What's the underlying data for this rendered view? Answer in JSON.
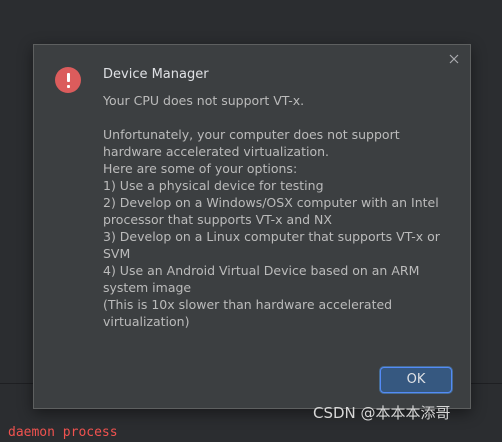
{
  "background": {
    "console_text": "daemon process"
  },
  "dialog": {
    "title": "Device Manager",
    "icon": "error-icon",
    "close_icon": "close-icon",
    "message_lines": [
      "Your CPU does not support VT-x.",
      "",
      "Unfortunately, your computer does not support",
      "hardware accelerated virtualization.",
      "Here are some of your options:",
      "1) Use a physical device for testing",
      "2) Develop on a Windows/OSX computer with an Intel",
      "processor that supports VT-x and NX",
      "3) Develop on a Linux computer that supports VT-x or",
      "SVM",
      "4) Use an Android Virtual Device based on an ARM",
      "system image",
      "(This is 10x slower than hardware accelerated",
      "virtualization)"
    ],
    "ok_label": "OK"
  },
  "watermark": "CSDN @本本本添哥",
  "colors": {
    "dialog_bg": "#3c3f41",
    "error_red": "#db5c5c",
    "ok_button": "#365880",
    "console_error": "#f0524f"
  }
}
